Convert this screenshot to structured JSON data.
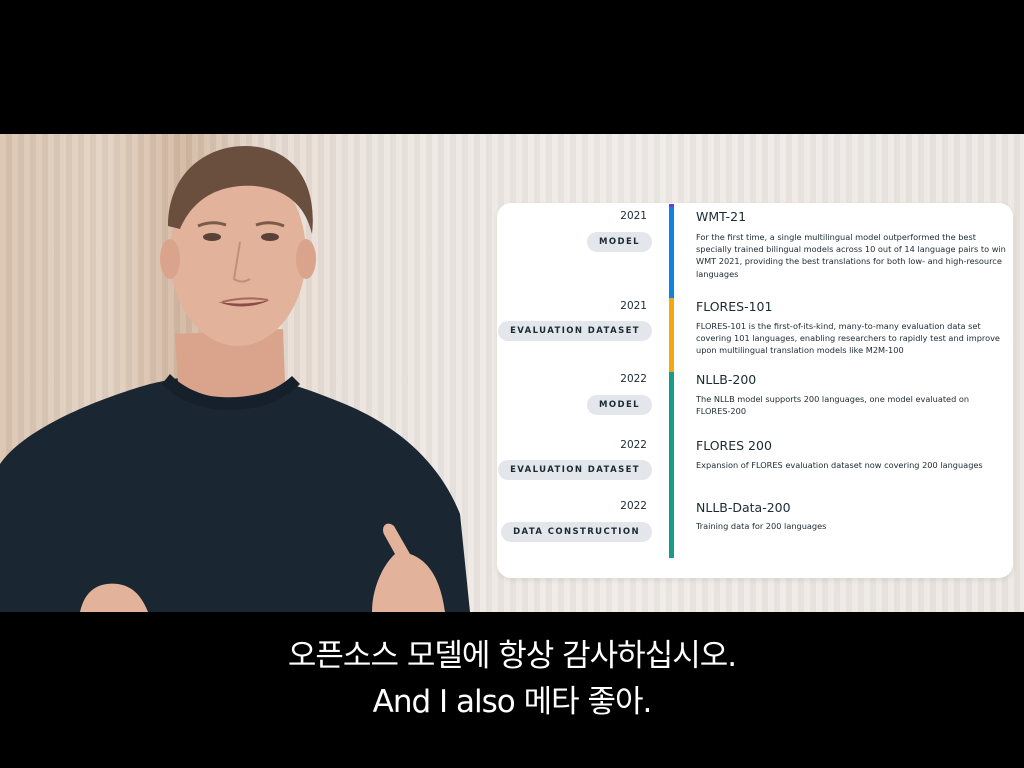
{
  "timeline": [
    {
      "year": "2021",
      "tag": "MODEL",
      "title": "WMT-21",
      "desc": "For the first time, a single multilingual model outperformed the best specially trained bilingual models across 10 out of 14 language pairs to win WMT 2021, providing the best translations for both low- and high-resource languages",
      "color": "#0c84e4"
    },
    {
      "year": "2021",
      "tag": "EVALUATION DATASET",
      "title": "FLORES-101",
      "desc": "FLORES-101 is the first-of-its-kind, many-to-many evaluation data set covering 101 languages, enabling researchers to rapidly test and improve upon multilingual translation models like M2M-100",
      "color": "#f2a90c"
    },
    {
      "year": "2022",
      "tag": "MODEL",
      "title": "NLLB-200",
      "desc": "The NLLB model supports 200 languages, one model evaluated on FLORES-200",
      "color": "#169c8c"
    },
    {
      "year": "2022",
      "tag": "EVALUATION DATASET",
      "title": "FLORES 200",
      "desc": "Expansion of FLORES evaluation dataset now covering 200 languages",
      "color": "#169c8c"
    },
    {
      "year": "2022",
      "tag": "DATA CONSTRUCTION",
      "title": "NLLB-Data-200",
      "desc": "Training data for 200 languages",
      "color": "#169c8c"
    }
  ],
  "subtitles": {
    "line1": "오픈소스 모델에 항상 감사하십시오.",
    "line2": "And I also 메타 좋아."
  }
}
